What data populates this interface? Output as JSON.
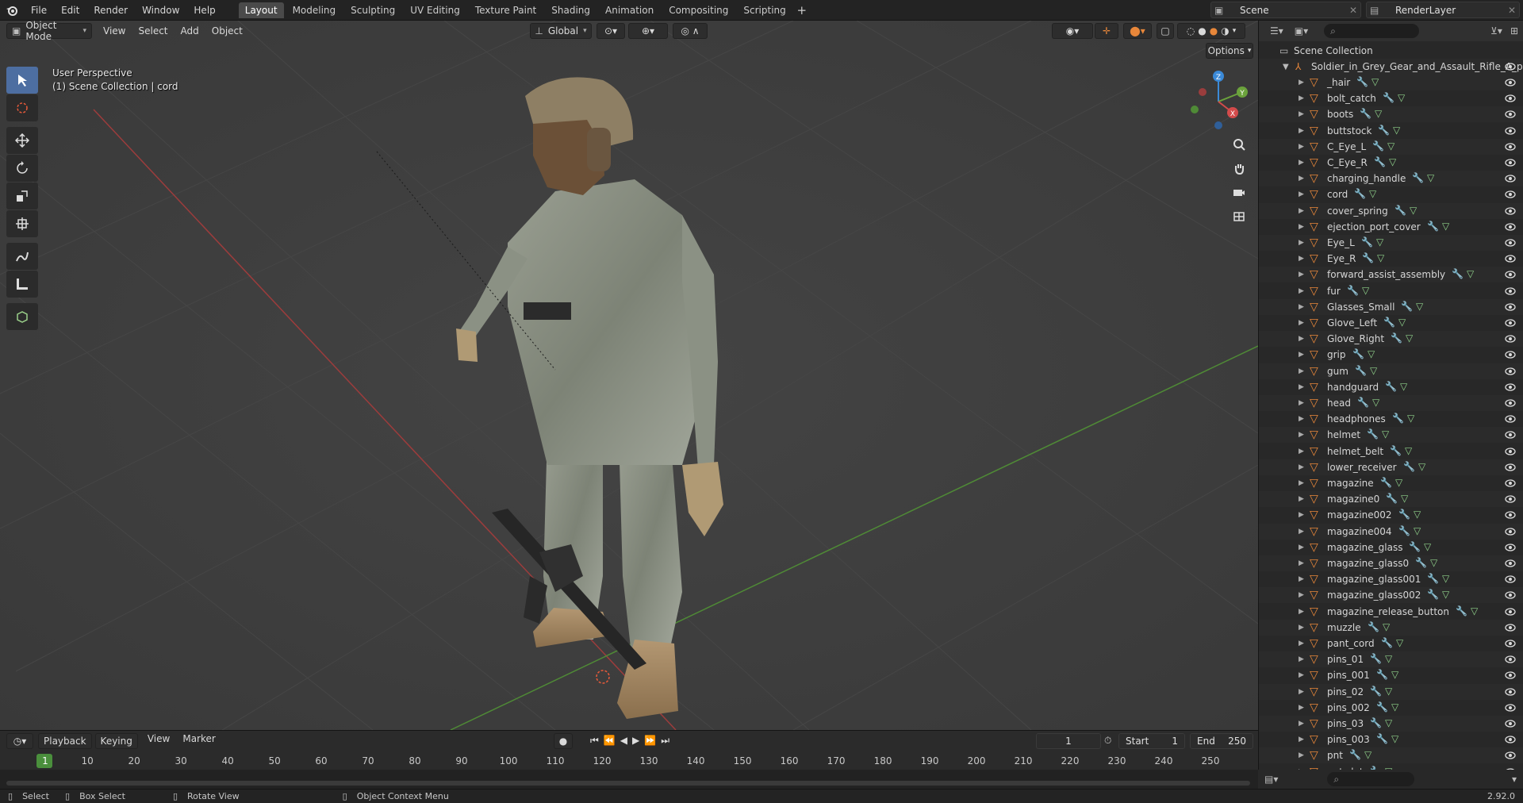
{
  "topbar": {
    "menus": [
      "File",
      "Edit",
      "Render",
      "Window",
      "Help"
    ],
    "tabs": [
      {
        "label": "Layout",
        "active": true
      },
      {
        "label": "Modeling",
        "active": false
      },
      {
        "label": "Sculpting",
        "active": false
      },
      {
        "label": "UV Editing",
        "active": false
      },
      {
        "label": "Texture Paint",
        "active": false
      },
      {
        "label": "Shading",
        "active": false
      },
      {
        "label": "Animation",
        "active": false
      },
      {
        "label": "Compositing",
        "active": false
      },
      {
        "label": "Scripting",
        "active": false
      }
    ],
    "add_tab": "+",
    "scene": "Scene",
    "view_layer": "RenderLayer"
  },
  "viewport": {
    "mode": "Object Mode",
    "menus": [
      "View",
      "Select",
      "Add",
      "Object"
    ],
    "orientation": "Global",
    "options": "Options",
    "perspective": "User Perspective",
    "context": "(1) Scene Collection | cord",
    "axes": {
      "x": "X",
      "y": "Y",
      "z": "Z"
    }
  },
  "outliner": {
    "root": "Scene Collection",
    "object": "Soldier_in_Grey_Gear_and_Assault_Rifle_A_p",
    "items": [
      "_hair",
      "bolt_catch",
      "boots",
      "buttstock",
      "C_Eye_L",
      "C_Eye_R",
      "charging_handle",
      "cord",
      "cover_spring",
      "ejection_port_cover",
      "Eye_L",
      "Eye_R",
      "forward_assist_assembly",
      "fur",
      "Glasses_Small",
      "Glove_Left",
      "Glove_Right",
      "grip",
      "gum",
      "handguard",
      "head",
      "headphones",
      "helmet",
      "helmet_belt",
      "lower_receiver",
      "magazine",
      "magazine0",
      "magazine002",
      "magazine004",
      "magazine_glass",
      "magazine_glass0",
      "magazine_glass001",
      "magazine_glass002",
      "magazine_release_button",
      "muzzle",
      "pant_cord",
      "pins_01",
      "pins_001",
      "pins_02",
      "pins_002",
      "pins_03",
      "pins_003",
      "pnt",
      "pnt_det"
    ]
  },
  "timeline": {
    "menus": [
      "Playback",
      "Keying",
      "View",
      "Marker"
    ],
    "current_frame": "1",
    "start_label": "Start",
    "start": "1",
    "end_label": "End",
    "end": "250",
    "ruler": [
      "1",
      "10",
      "20",
      "30",
      "40",
      "50",
      "60",
      "70",
      "80",
      "90",
      "100",
      "110",
      "120",
      "130",
      "140",
      "150",
      "160",
      "170",
      "180",
      "190",
      "200",
      "210",
      "220",
      "230",
      "240",
      "250"
    ]
  },
  "statusbar": {
    "select": "Select",
    "box_select": "Box Select",
    "rotate": "Rotate View",
    "context_menu": "Object Context Menu",
    "version": "2.92.0"
  },
  "colors": {
    "accent": "#4772b3",
    "icon_orange": "#e8873a",
    "axis_x": "#d34b4b",
    "axis_y": "#6ba33c",
    "axis_z": "#3b8ad8"
  }
}
